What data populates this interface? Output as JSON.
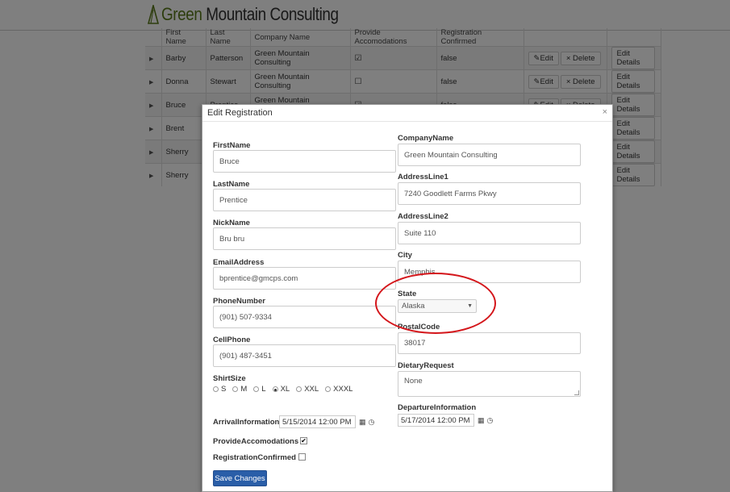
{
  "header": {
    "brand_green": "Green",
    "brand_rest": " Mountain Consulting",
    "brand_color": "#5a7a1a"
  },
  "grid": {
    "columns": [
      "",
      "First Name",
      "Last Name",
      "Company Name",
      "Provide Accomodations",
      "Registration Confirmed",
      "",
      ""
    ],
    "rows": [
      {
        "first": "Barby",
        "last": "Patterson",
        "company": "Green Mountain Consulting",
        "accom": "☑",
        "confirmed": "false",
        "edit": "Edit",
        "delete": "Delete",
        "details": "Edit Details"
      },
      {
        "first": "Donna",
        "last": "Stewart",
        "company": "Green Mountain Consulting",
        "accom": "☐",
        "confirmed": "false",
        "edit": "Edit",
        "delete": "Delete",
        "details": "Edit Details"
      },
      {
        "first": "Bruce",
        "last": "Prentice",
        "company": "Green Mountain Consulting",
        "accom": "☑",
        "confirmed": "false",
        "edit": "Edit",
        "delete": "Delete",
        "details": "Edit Details"
      },
      {
        "first": "Brent",
        "last": "",
        "company": "",
        "accom": "",
        "confirmed": "",
        "edit": "",
        "delete": "",
        "details": "Edit Details"
      },
      {
        "first": "Sherry",
        "last": "",
        "company": "",
        "accom": "",
        "confirmed": "",
        "edit": "",
        "delete": "",
        "details": "Edit Details"
      },
      {
        "first": "Sherry",
        "last": "",
        "company": "",
        "accom": "",
        "confirmed": "",
        "edit": "",
        "delete": "",
        "details": "Edit Details"
      }
    ]
  },
  "modal": {
    "title": "Edit Registration",
    "close": "×",
    "left": {
      "first_name_label": "FirstName",
      "first_name": "Bruce",
      "last_name_label": "LastName",
      "last_name": "Prentice",
      "nick_name_label": "NickName",
      "nick_name": "Bru bru",
      "email_label": "EmailAddress",
      "email": "bprentice@gmcps.com",
      "phone_label": "PhoneNumber",
      "phone": "(901) 507-9334",
      "cell_label": "CellPhone",
      "cell": "(901) 487-3451",
      "shirt_label": "ShirtSize",
      "shirt_options": [
        "S",
        "M",
        "L",
        "XL",
        "XXL",
        "XXXL"
      ],
      "shirt_selected": "XL",
      "arrival_label": "ArrivalInformation",
      "arrival": "5/15/2014 12:00 PM",
      "provide_label": "ProvideAccomodations",
      "provide_checked": true,
      "confirmed_label": "RegistrationConfirmed",
      "confirmed_checked": false,
      "save": "Save Changes"
    },
    "right": {
      "company_label": "CompanyName",
      "company": "Green Mountain Consulting",
      "addr1_label": "AddressLine1",
      "addr1": "7240 Goodlett Farms Pkwy",
      "addr2_label": "AddressLine2",
      "addr2": "Suite 110",
      "city_label": "City",
      "city": "Memphis",
      "state_label": "State",
      "state": "Alaska",
      "postal_label": "PostalCode",
      "postal": "38017",
      "dietary_label": "DietaryRequest",
      "dietary": "None",
      "departure_label": "DepartureInformation",
      "departure": "5/17/2014 12:00 PM"
    }
  },
  "colors": {
    "save_button": "#2a5ea8",
    "annotation": "#d4161b"
  }
}
